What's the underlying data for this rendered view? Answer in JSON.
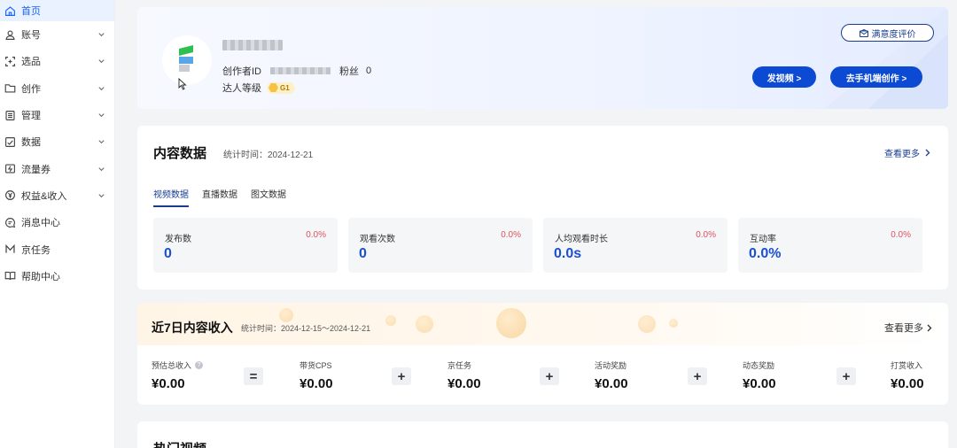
{
  "sidebar": {
    "items": [
      {
        "label": "首页",
        "icon": "home-icon",
        "active": true
      },
      {
        "label": "账号",
        "icon": "user-icon"
      },
      {
        "label": "选品",
        "icon": "scan-icon"
      },
      {
        "label": "创作",
        "icon": "folder-icon"
      },
      {
        "label": "管理",
        "icon": "list-icon"
      },
      {
        "label": "数据",
        "icon": "chart-check-icon"
      },
      {
        "label": "流量券",
        "icon": "ticket-icon"
      },
      {
        "label": "权益&收入",
        "icon": "yen-icon"
      },
      {
        "label": "消息中心",
        "icon": "message-icon"
      },
      {
        "label": "京任务",
        "icon": "m-icon"
      },
      {
        "label": "帮助中心",
        "icon": "book-icon"
      }
    ]
  },
  "profile": {
    "creator_id_label": "创作者ID",
    "fans_label": "粉丝",
    "fans_count": "0",
    "level_label": "达人等级",
    "level_badge": "G1",
    "survey_button": "满意度评价",
    "video_button": "发视频 >",
    "mobile_button": "去手机端创作 >"
  },
  "content": {
    "title": "内容数据",
    "stat_time": "统计时间：2024-12-21",
    "more": "查看更多",
    "tabs": [
      "视频数据",
      "直播数据",
      "图文数据"
    ],
    "stats": [
      {
        "label": "发布数",
        "pct": "0.0%",
        "value": "0"
      },
      {
        "label": "观看次数",
        "pct": "0.0%",
        "value": "0"
      },
      {
        "label": "人均观看时长",
        "pct": "0.0%",
        "value": "0.0s"
      },
      {
        "label": "互动率",
        "pct": "0.0%",
        "value": "0.0%"
      }
    ]
  },
  "income": {
    "title": "近7日内容收入",
    "stat_time": "统计时间：2024-12-15～2024-12-21",
    "more": "查看更多",
    "items": [
      {
        "label": "预估总收入",
        "value": "¥0.00"
      },
      {
        "label": "带货CPS",
        "value": "¥0.00"
      },
      {
        "label": "京任务",
        "value": "¥0.00"
      },
      {
        "label": "活动奖励",
        "value": "¥0.00"
      },
      {
        "label": "动态奖励",
        "value": "¥0.00"
      },
      {
        "label": "打赏收入",
        "value": "¥0.00"
      }
    ],
    "operators": [
      "=",
      "+",
      "+",
      "+",
      "+"
    ]
  },
  "hot": {
    "title": "热门视频"
  },
  "colors": {
    "primary": "#1664ff",
    "button": "#0d4ad3",
    "accent_text": "#1a3d8f",
    "negative": "#e0505f"
  }
}
